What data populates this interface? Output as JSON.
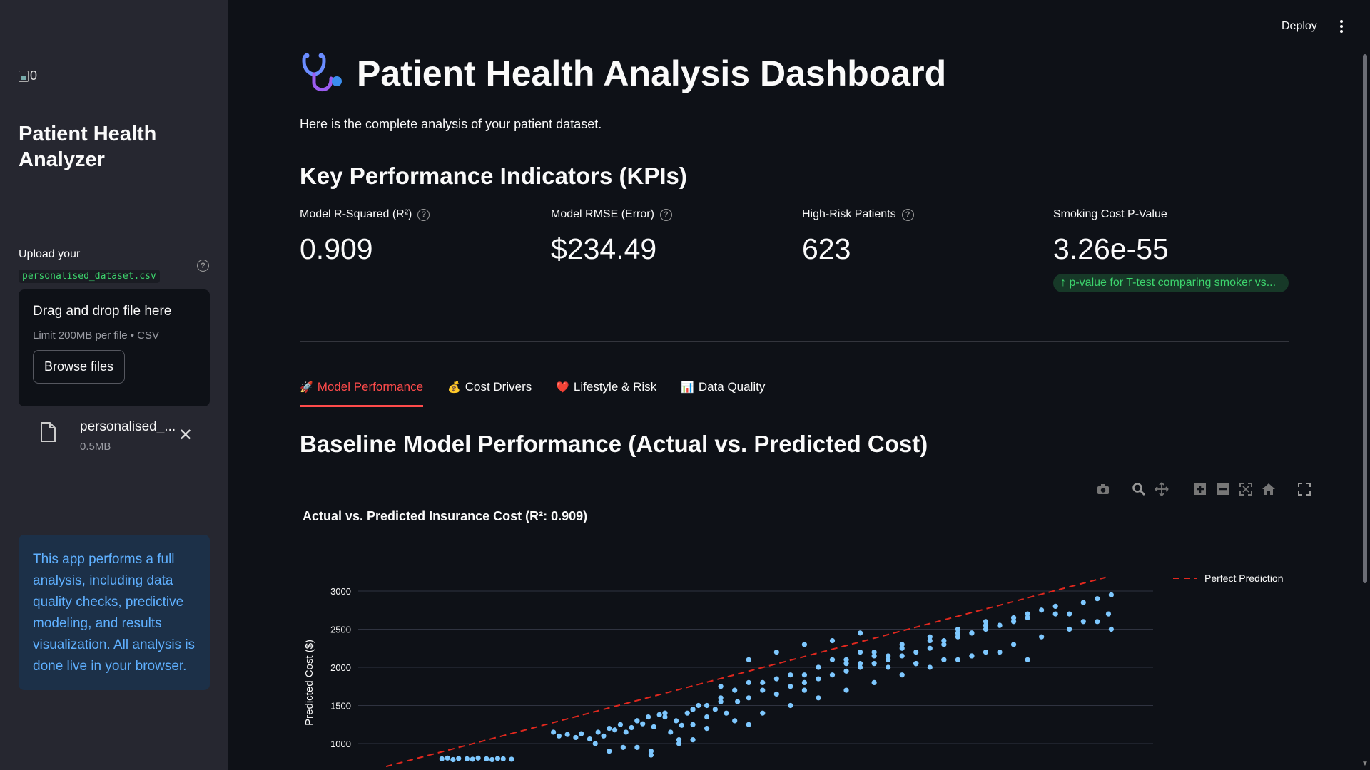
{
  "sidebar": {
    "broken_image_alt": "0",
    "app_title": "Patient Health Analyzer",
    "upload_label": "Upload your",
    "upload_filename_code": "personalised_dataset.csv",
    "dropzone_title": "Drag and drop file here",
    "dropzone_limit": "Limit 200MB per file • CSV",
    "browse_label": "Browse files",
    "uploaded_file_name": "personalised_...",
    "uploaded_file_size": "0.5MB",
    "info_text": "This app performs a full analysis, including data quality checks, predictive modeling, and results visualization. All analysis is done live in your browser."
  },
  "header": {
    "deploy_label": "Deploy"
  },
  "main": {
    "title": "Patient Health Analysis Dashboard",
    "intro": "Here is the complete analysis of your patient dataset.",
    "kpi_heading": "Key Performance Indicators (KPIs)",
    "kpis": [
      {
        "label": "Model R-Squared (R²)",
        "value": "0.909"
      },
      {
        "label": "Model RMSE (Error)",
        "value": "$234.49"
      },
      {
        "label": "High-Risk Patients",
        "value": "623"
      },
      {
        "label": "Smoking Cost P-Value",
        "value": "3.26e-55",
        "delta": "p-value for T-test comparing smoker vs..."
      }
    ],
    "tabs": [
      {
        "emoji": "🚀",
        "label": "Model Performance"
      },
      {
        "emoji": "💰",
        "label": "Cost Drivers"
      },
      {
        "emoji": "❤️",
        "label": "Lifestyle & Risk"
      },
      {
        "emoji": "📊",
        "label": "Data Quality"
      }
    ],
    "section_title": "Baseline Model Performance (Actual vs. Predicted Cost)",
    "chart_title": "Actual vs. Predicted Insurance Cost (R²: 0.909)"
  },
  "colors": {
    "accent": "#ff4b4b",
    "point": "#7ec8ff",
    "line": "#e0281e",
    "success": "#3dd56d",
    "info": "#5fb0ff"
  },
  "chart_data": {
    "type": "scatter",
    "title": "Actual vs. Predicted Insurance Cost (R²: 0.909)",
    "ylabel": "Predicted Cost ($)",
    "xlabel": "",
    "y_ticks": [
      1000,
      1500,
      2000,
      2500,
      3000
    ],
    "ylim": [
      750,
      3250
    ],
    "xlim": [
      600,
      3450
    ],
    "legend": {
      "position": "top-right",
      "entries": [
        "Perfect Prediction"
      ]
    },
    "series": [
      {
        "name": "Perfect Prediction",
        "kind": "line",
        "x": [
          700,
          3280
        ],
        "y": [
          700,
          3180
        ]
      },
      {
        "kind": "scatter",
        "x": [
          900,
          920,
          940,
          960,
          990,
          1010,
          1030,
          1060,
          1080,
          1100,
          1120,
          1150,
          1300,
          1320,
          1350,
          1380,
          1400,
          1430,
          1460,
          1480,
          1500,
          1520,
          1540,
          1560,
          1580,
          1600,
          1620,
          1640,
          1660,
          1680,
          1700,
          1720,
          1740,
          1760,
          1780,
          1800,
          1820,
          1850,
          1880,
          1900,
          1920,
          1960,
          2000,
          2050,
          2100,
          2150,
          2200,
          2250,
          2300,
          2350,
          2400,
          2450,
          2500,
          2550,
          2600,
          2650,
          2700,
          2750,
          2800,
          2850,
          2900,
          2950,
          3000,
          3050,
          3100,
          3150,
          3200,
          3250,
          3290,
          3300,
          1450,
          1550,
          1650,
          1750,
          1850,
          1950,
          2050,
          2150,
          2250,
          2350,
          2450,
          2550,
          2650,
          2750,
          2850,
          2950,
          3050,
          3150,
          3250,
          2000,
          2100,
          2200,
          2300,
          2400,
          2500,
          2600,
          2700,
          2800,
          2900,
          3000,
          2300,
          2400,
          2500,
          2600,
          2700,
          2800,
          1900,
          2000,
          2100,
          2200,
          2250,
          2350,
          2450,
          2550,
          2650,
          2750,
          2850,
          2950,
          1700,
          1800,
          1850,
          1900,
          1950,
          2050,
          2150,
          2250,
          2350,
          2450,
          2550,
          2650,
          2750,
          2850,
          1600,
          1700,
          1800,
          2400,
          2600,
          2700,
          2800,
          2900,
          3000,
          3100,
          3200,
          3300,
          1500,
          1600,
          1650,
          1750,
          1800,
          2000,
          2200
        ],
        "y": [
          800,
          810,
          790,
          805,
          800,
          795,
          810,
          800,
          790,
          805,
          800,
          795,
          1150,
          1100,
          1120,
          1080,
          1130,
          1060,
          1150,
          1100,
          1200,
          1180,
          1250,
          1150,
          1210,
          1300,
          1260,
          1350,
          1220,
          1380,
          1400,
          1150,
          1300,
          1240,
          1400,
          1450,
          1500,
          1350,
          1450,
          1550,
          1400,
          1550,
          1600,
          1700,
          1650,
          1750,
          1800,
          1850,
          1900,
          1950,
          2000,
          2050,
          2100,
          2150,
          2200,
          2250,
          2300,
          2400,
          2450,
          2500,
          2550,
          2600,
          2700,
          2750,
          2800,
          2700,
          2850,
          2900,
          2700,
          2950,
          1000,
          950,
          900,
          1050,
          1200,
          1300,
          1400,
          1500,
          1600,
          1700,
          1800,
          1900,
          2000,
          2100,
          2200,
          2300,
          2400,
          2500,
          2600,
          2100,
          2200,
          2300,
          2350,
          2450,
          2150,
          2050,
          2350,
          2450,
          2550,
          2650,
          2100,
          2200,
          2000,
          2050,
          2100,
          2150,
          1750,
          1800,
          1850,
          1900,
          2000,
          2050,
          2150,
          2250,
          2350,
          2450,
          2550,
          2650,
          1400,
          1450,
          1500,
          1600,
          1700,
          1800,
          1900,
          2000,
          2100,
          2200,
          2300,
          2400,
          2500,
          2600,
          1300,
          1350,
          1250,
          2050,
          2050,
          2100,
          2150,
          2200,
          2100,
          2700,
          2600,
          2500,
          900,
          950,
          850,
          1000,
          1050,
          1250,
          1700
        ]
      }
    ]
  }
}
